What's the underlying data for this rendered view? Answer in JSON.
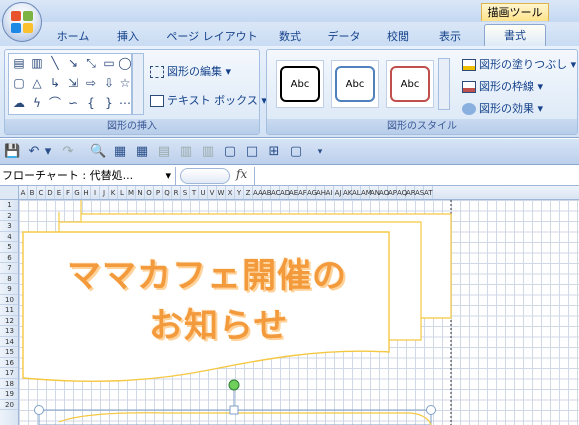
{
  "contextual_tab_label": "描画ツール",
  "tabs": [
    "ホーム",
    "挿入",
    "ページ レイアウト",
    "数式",
    "データ",
    "校閲",
    "表示"
  ],
  "active_tab": "書式",
  "ribbon": {
    "insert_group_label": "図形の挿入",
    "style_group_label": "図形のスタイル",
    "edit_shape": "図形の編集",
    "text_box": "テキスト ボックス",
    "swatch_text": "Abc",
    "fill": "図形の塗りつぶし",
    "outline": "図形の枠線",
    "effects": "図形の効果"
  },
  "name_box": "フローチャート : 代替処...",
  "formula_fx": "fx",
  "columns": [
    "A",
    "B",
    "C",
    "D",
    "E",
    "F",
    "G",
    "H",
    "I",
    "J",
    "K",
    "L",
    "M",
    "N",
    "O",
    "P",
    "Q",
    "R",
    "S",
    "T",
    "U",
    "V",
    "W",
    "X",
    "Y",
    "Z",
    "AA",
    "AB",
    "AC",
    "AD",
    "AE",
    "AF",
    "AG",
    "AH",
    "AI",
    "AJ",
    "AK",
    "AL",
    "AM",
    "AN",
    "AO",
    "AP",
    "AQ",
    "AR",
    "AS",
    "AT"
  ],
  "rows": [
    "1",
    "2",
    "3",
    "4",
    "5",
    "6",
    "7",
    "8",
    "9",
    "10",
    "11",
    "12",
    "13",
    "14",
    "15",
    "16",
    "17",
    "18",
    "19",
    "20"
  ],
  "banner": {
    "line1": "ママカフェ開催の",
    "line2": "お知らせ"
  },
  "colors": {
    "banner_border": "#f5c842",
    "banner_text": "#f39a3c",
    "handle_green": "#4caf50",
    "ribbon_text": "#15428b"
  }
}
